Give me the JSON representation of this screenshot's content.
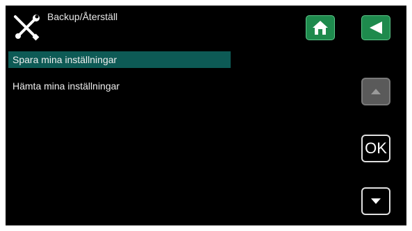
{
  "header": {
    "title": "Backup/Återställ",
    "icon": "tools-icon",
    "home_icon": "home-icon",
    "back_icon": "back-arrow-icon"
  },
  "menu": {
    "items": [
      {
        "label": "Spara mina inställningar",
        "selected": true
      },
      {
        "label": "Hämta mina inställningar",
        "selected": false
      }
    ]
  },
  "nav": {
    "up_icon": "arrow-up-icon",
    "ok_label": "OK",
    "down_icon": "arrow-down-icon"
  },
  "colors": {
    "screen_bg": "#000000",
    "selected_bg": "#0d5a55",
    "accent_green": "#1e8a4d"
  }
}
